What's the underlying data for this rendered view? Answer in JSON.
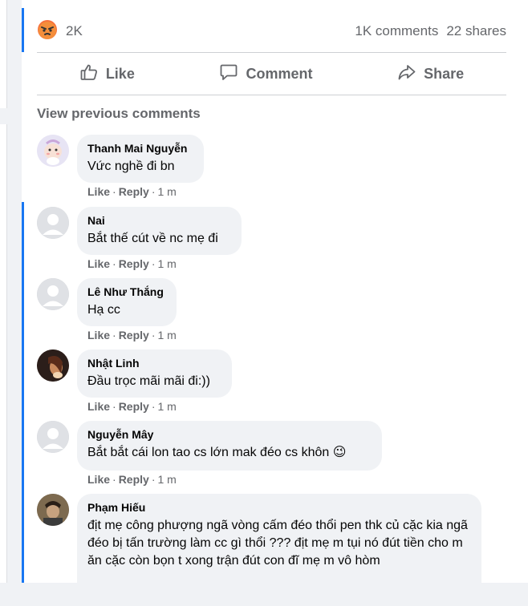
{
  "post": {
    "reaction_icon": "angry-reaction-icon",
    "reaction_count": "2K",
    "comments_count": "1K comments",
    "shares_count": "22 shares"
  },
  "actions": {
    "like": "Like",
    "comment": "Comment",
    "share": "Share"
  },
  "view_previous": "View previous comments",
  "comments": [
    {
      "name": "Thanh Mai Nguyễn",
      "text": "Vức nghề đi bn",
      "like": "Like",
      "reply": "Reply",
      "time": "1 m",
      "avatar": "cartoon-avatar"
    },
    {
      "name": "Nai",
      "text": "Bắt thế cút về nc mẹ đi",
      "like": "Like",
      "reply": "Reply",
      "time": "1 m",
      "avatar": "default-avatar"
    },
    {
      "name": "Lê Như Thắng",
      "text": "Hạ cc",
      "like": "Like",
      "reply": "Reply",
      "time": "1 m",
      "avatar": "default-avatar"
    },
    {
      "name": "Nhật Linh",
      "text": "Đầu trọc mãi mãi đi:))",
      "like": "Like",
      "reply": "Reply",
      "time": "1 m",
      "avatar": "photo-avatar"
    },
    {
      "name": "Nguyễn Mây",
      "text": "Bắt bắt cái lon tao cs lớn mak đéo cs khôn 😉",
      "like": "Like",
      "reply": "Reply",
      "time": "1 m",
      "avatar": "default-avatar"
    },
    {
      "name": "Phạm Hiếu",
      "text": "địt mẹ công phượng ngã vòng cấm đéo thổi pen thk củ cặc kia ngã đéo bị tấn trường làm cc gì thổi ??? địt mẹ m tụi nó đút tiền cho m ăn cặc còn bọn t xong trận đút con đĩ mẹ m vô hòm",
      "like": "",
      "reply": "",
      "time": "",
      "avatar": "photo-avatar"
    }
  ],
  "colors": {
    "accent": "#1877f2",
    "reaction": "#f7713c",
    "muted_text": "#65676b",
    "bubble": "#f0f2f5"
  }
}
